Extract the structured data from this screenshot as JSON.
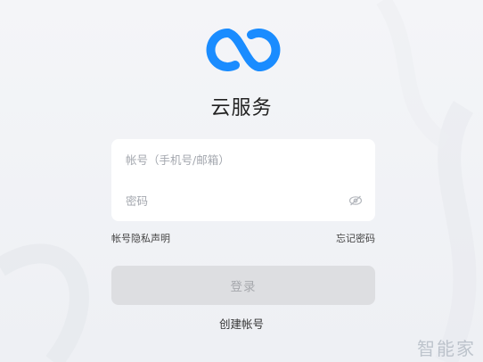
{
  "app": {
    "title": "云服务",
    "brand_color": "#1a8cff"
  },
  "login_form": {
    "account_placeholder": "帐号（手机号/邮箱）",
    "password_placeholder": "密码",
    "password_toggle_icon": "eye-off-icon"
  },
  "links": {
    "privacy": "帐号隐私声明",
    "forgot_password": "忘记密码",
    "create_account": "创建帐号"
  },
  "actions": {
    "login_label": "登录"
  },
  "watermark": "智能家"
}
